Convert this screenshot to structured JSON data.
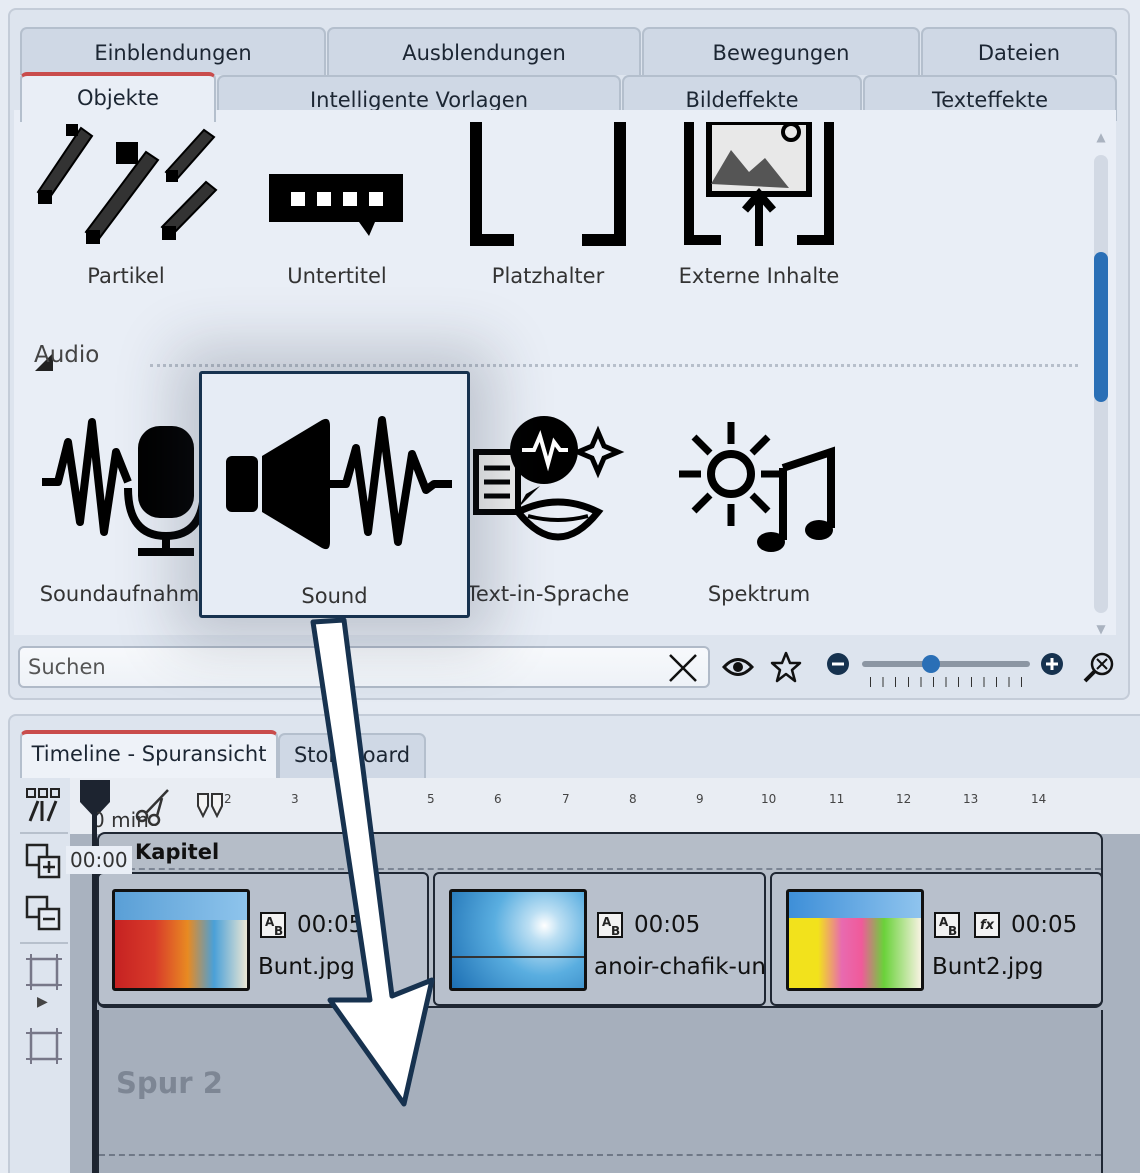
{
  "tabs_row1": [
    "Einblendungen",
    "Ausblendungen",
    "Bewegungen",
    "Dateien"
  ],
  "tabs_row2": [
    "Objekte",
    "Intelligente Vorlagen",
    "Bildeffekte",
    "Texteffekte"
  ],
  "active_tab": "Objekte",
  "objects": {
    "items": [
      "Partikel",
      "Untertitel",
      "Platzhalter",
      "Externe Inhalte"
    ]
  },
  "audio": {
    "section_title": "Audio",
    "items": [
      "Soundaufnahme",
      "Sound",
      "Text-in-Sprache",
      "Spektrum"
    ],
    "dragged_item": "Sound"
  },
  "search": {
    "placeholder": "Suchen"
  },
  "icons": {
    "clear": "close-icon",
    "view": "eye-icon",
    "favorite": "star-icon",
    "zoom_out": "minus-circle-icon",
    "zoom_in": "plus-circle-icon",
    "zoom_fit": "zoom-fit-icon"
  },
  "zoom_level": 0.4,
  "lower_tabs": [
    "Timeline - Spuransicht",
    "Storyboard"
  ],
  "ruler": {
    "unit_label": "0 min",
    "current_time": "00:00",
    "ticks": [
      "2",
      "3",
      "5",
      "6",
      "7",
      "8",
      "9",
      "10",
      "11",
      "12",
      "13",
      "14"
    ]
  },
  "timeline": {
    "chapter_title": "Kapitel",
    "clips": [
      {
        "duration": "00:05",
        "name": "Bunt.jpg"
      },
      {
        "duration": "00:05",
        "name": "anoir-chafik-unsplash"
      },
      {
        "duration": "00:05",
        "name": "Bunt2.jpg"
      }
    ],
    "track2_label": "Spur 2"
  },
  "colors": {
    "accent": "#2a6fb6",
    "active_tab_marker": "#c94c4c",
    "drag_border": "#17324f"
  }
}
